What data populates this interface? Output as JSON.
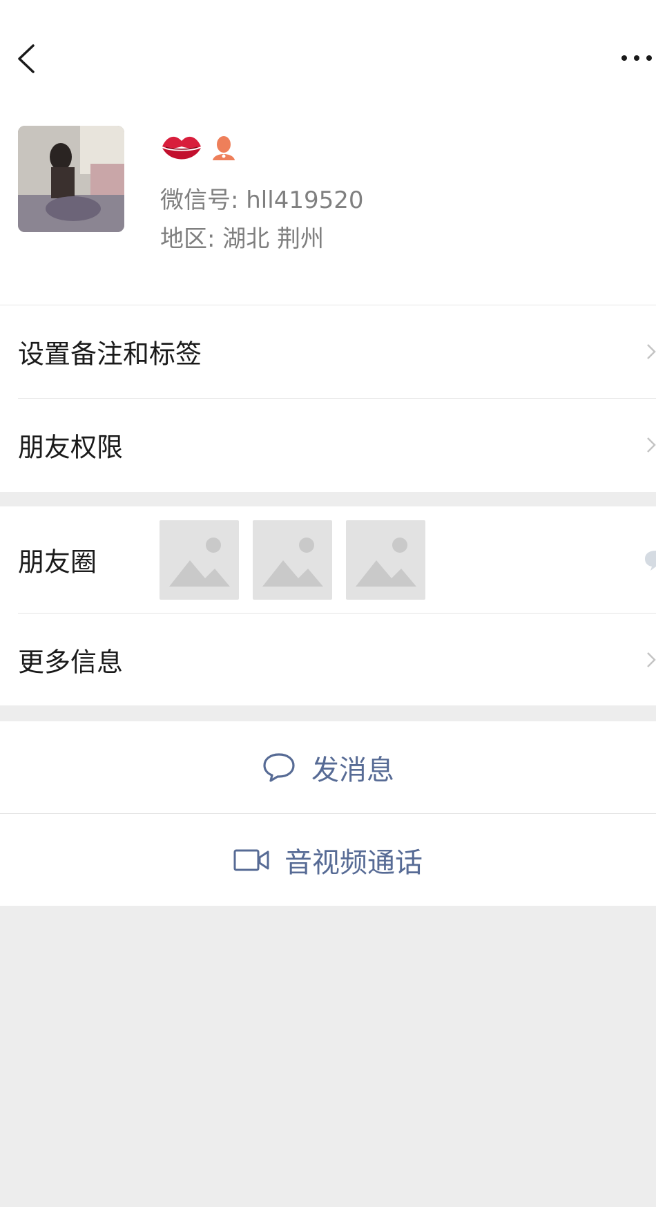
{
  "header": {
    "back_icon": "chevron-left-icon",
    "more_icon": "more-dots-icon"
  },
  "profile": {
    "badge_icons": [
      "lips-emoji-icon",
      "female-person-icon"
    ],
    "wechat_id_text": "微信号: hll419520",
    "region_text": "地区: 湖北  荆州",
    "badge_colors": {
      "lips": "#d81e3c",
      "person": "#ee7f5a"
    }
  },
  "settings": {
    "remark_tags_label": "设置备注和标签",
    "friend_permissions_label": "朋友权限"
  },
  "moments": {
    "label": "朋友圈",
    "thumbnail_count": 3
  },
  "more_info": {
    "label": "更多信息"
  },
  "actions": {
    "send_message_label": "发消息",
    "send_message_icon": "chat-bubble-icon",
    "av_call_label": "音视频通话",
    "av_call_icon": "video-camera-icon"
  },
  "colors": {
    "link_blue": "#576b95",
    "secondary_text": "#7f7f7f",
    "background": "#ededed"
  }
}
